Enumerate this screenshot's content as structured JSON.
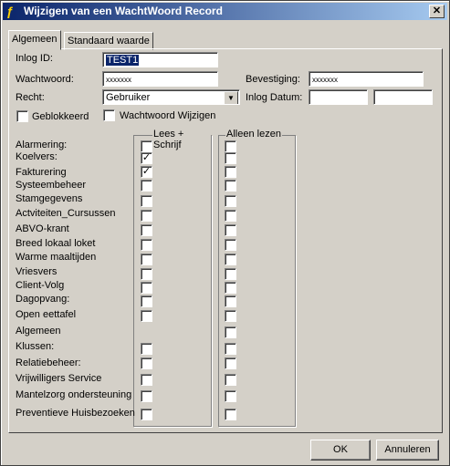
{
  "window": {
    "title": "Wijzigen van een WachtWoord Record",
    "close_glyph": "✕",
    "icon": "app-icon"
  },
  "tabs": [
    {
      "label": "Algemeen"
    },
    {
      "label": "Standaard waarde"
    }
  ],
  "form": {
    "login_id": {
      "label": "Inlog ID:",
      "value": "TEST1"
    },
    "password": {
      "label": "Wachtwoord:",
      "value": "xxxxxxx"
    },
    "confirmation": {
      "label": "Bevestiging:",
      "value": "xxxxxxx"
    },
    "right": {
      "label": "Recht:",
      "value": "Gebruiker"
    },
    "login_date": {
      "label": "Inlog Datum:",
      "value1": "",
      "value2": ""
    },
    "blocked": {
      "label": "Geblokkeerd",
      "checked": false
    },
    "change_password": {
      "label": "Wachtwoord Wijzigen",
      "checked": false
    }
  },
  "groups": {
    "read_write": "Lees + Schrijf",
    "read_only": "Alleen lezen"
  },
  "permissions": [
    {
      "label": "Alarmering:",
      "rw": false,
      "ro": false
    },
    {
      "label": "Koelvers:",
      "rw": true,
      "ro": false
    },
    {
      "label": "Fakturering",
      "rw": true,
      "ro": false
    },
    {
      "label": "Systeembeheer",
      "rw": false,
      "ro": false
    },
    {
      "label": "Stamgegevens",
      "rw": false,
      "ro": false
    },
    {
      "label": "Actviteiten_Cursussen",
      "rw": false,
      "ro": false
    },
    {
      "label": "ABVO-krant",
      "rw": false,
      "ro": false
    },
    {
      "label": "Breed lokaal loket",
      "rw": false,
      "ro": false
    },
    {
      "label": "Warme maaltijden",
      "rw": false,
      "ro": false
    },
    {
      "label": "Vriesvers",
      "rw": false,
      "ro": false
    },
    {
      "label": "Client-Volg",
      "rw": false,
      "ro": false
    },
    {
      "label": "Dagopvang:",
      "rw": false,
      "ro": false
    },
    {
      "label": "Open eettafel",
      "rw": false,
      "ro": false
    },
    {
      "label": "Algemeen",
      "rw": null,
      "ro": false
    },
    {
      "label": "Klussen:",
      "rw": false,
      "ro": false
    },
    {
      "label": "Relatiebeheer:",
      "rw": false,
      "ro": false
    },
    {
      "label": "Vrijwilligers Service",
      "rw": false,
      "ro": false
    },
    {
      "label": "Mantelzorg ondersteuning",
      "rw": false,
      "ro": false
    },
    {
      "label": "Preventieve Huisbezoeken",
      "rw": false,
      "ro": false
    }
  ],
  "buttons": {
    "ok": "OK",
    "cancel": "Annuleren"
  },
  "check_glyph": "✓"
}
